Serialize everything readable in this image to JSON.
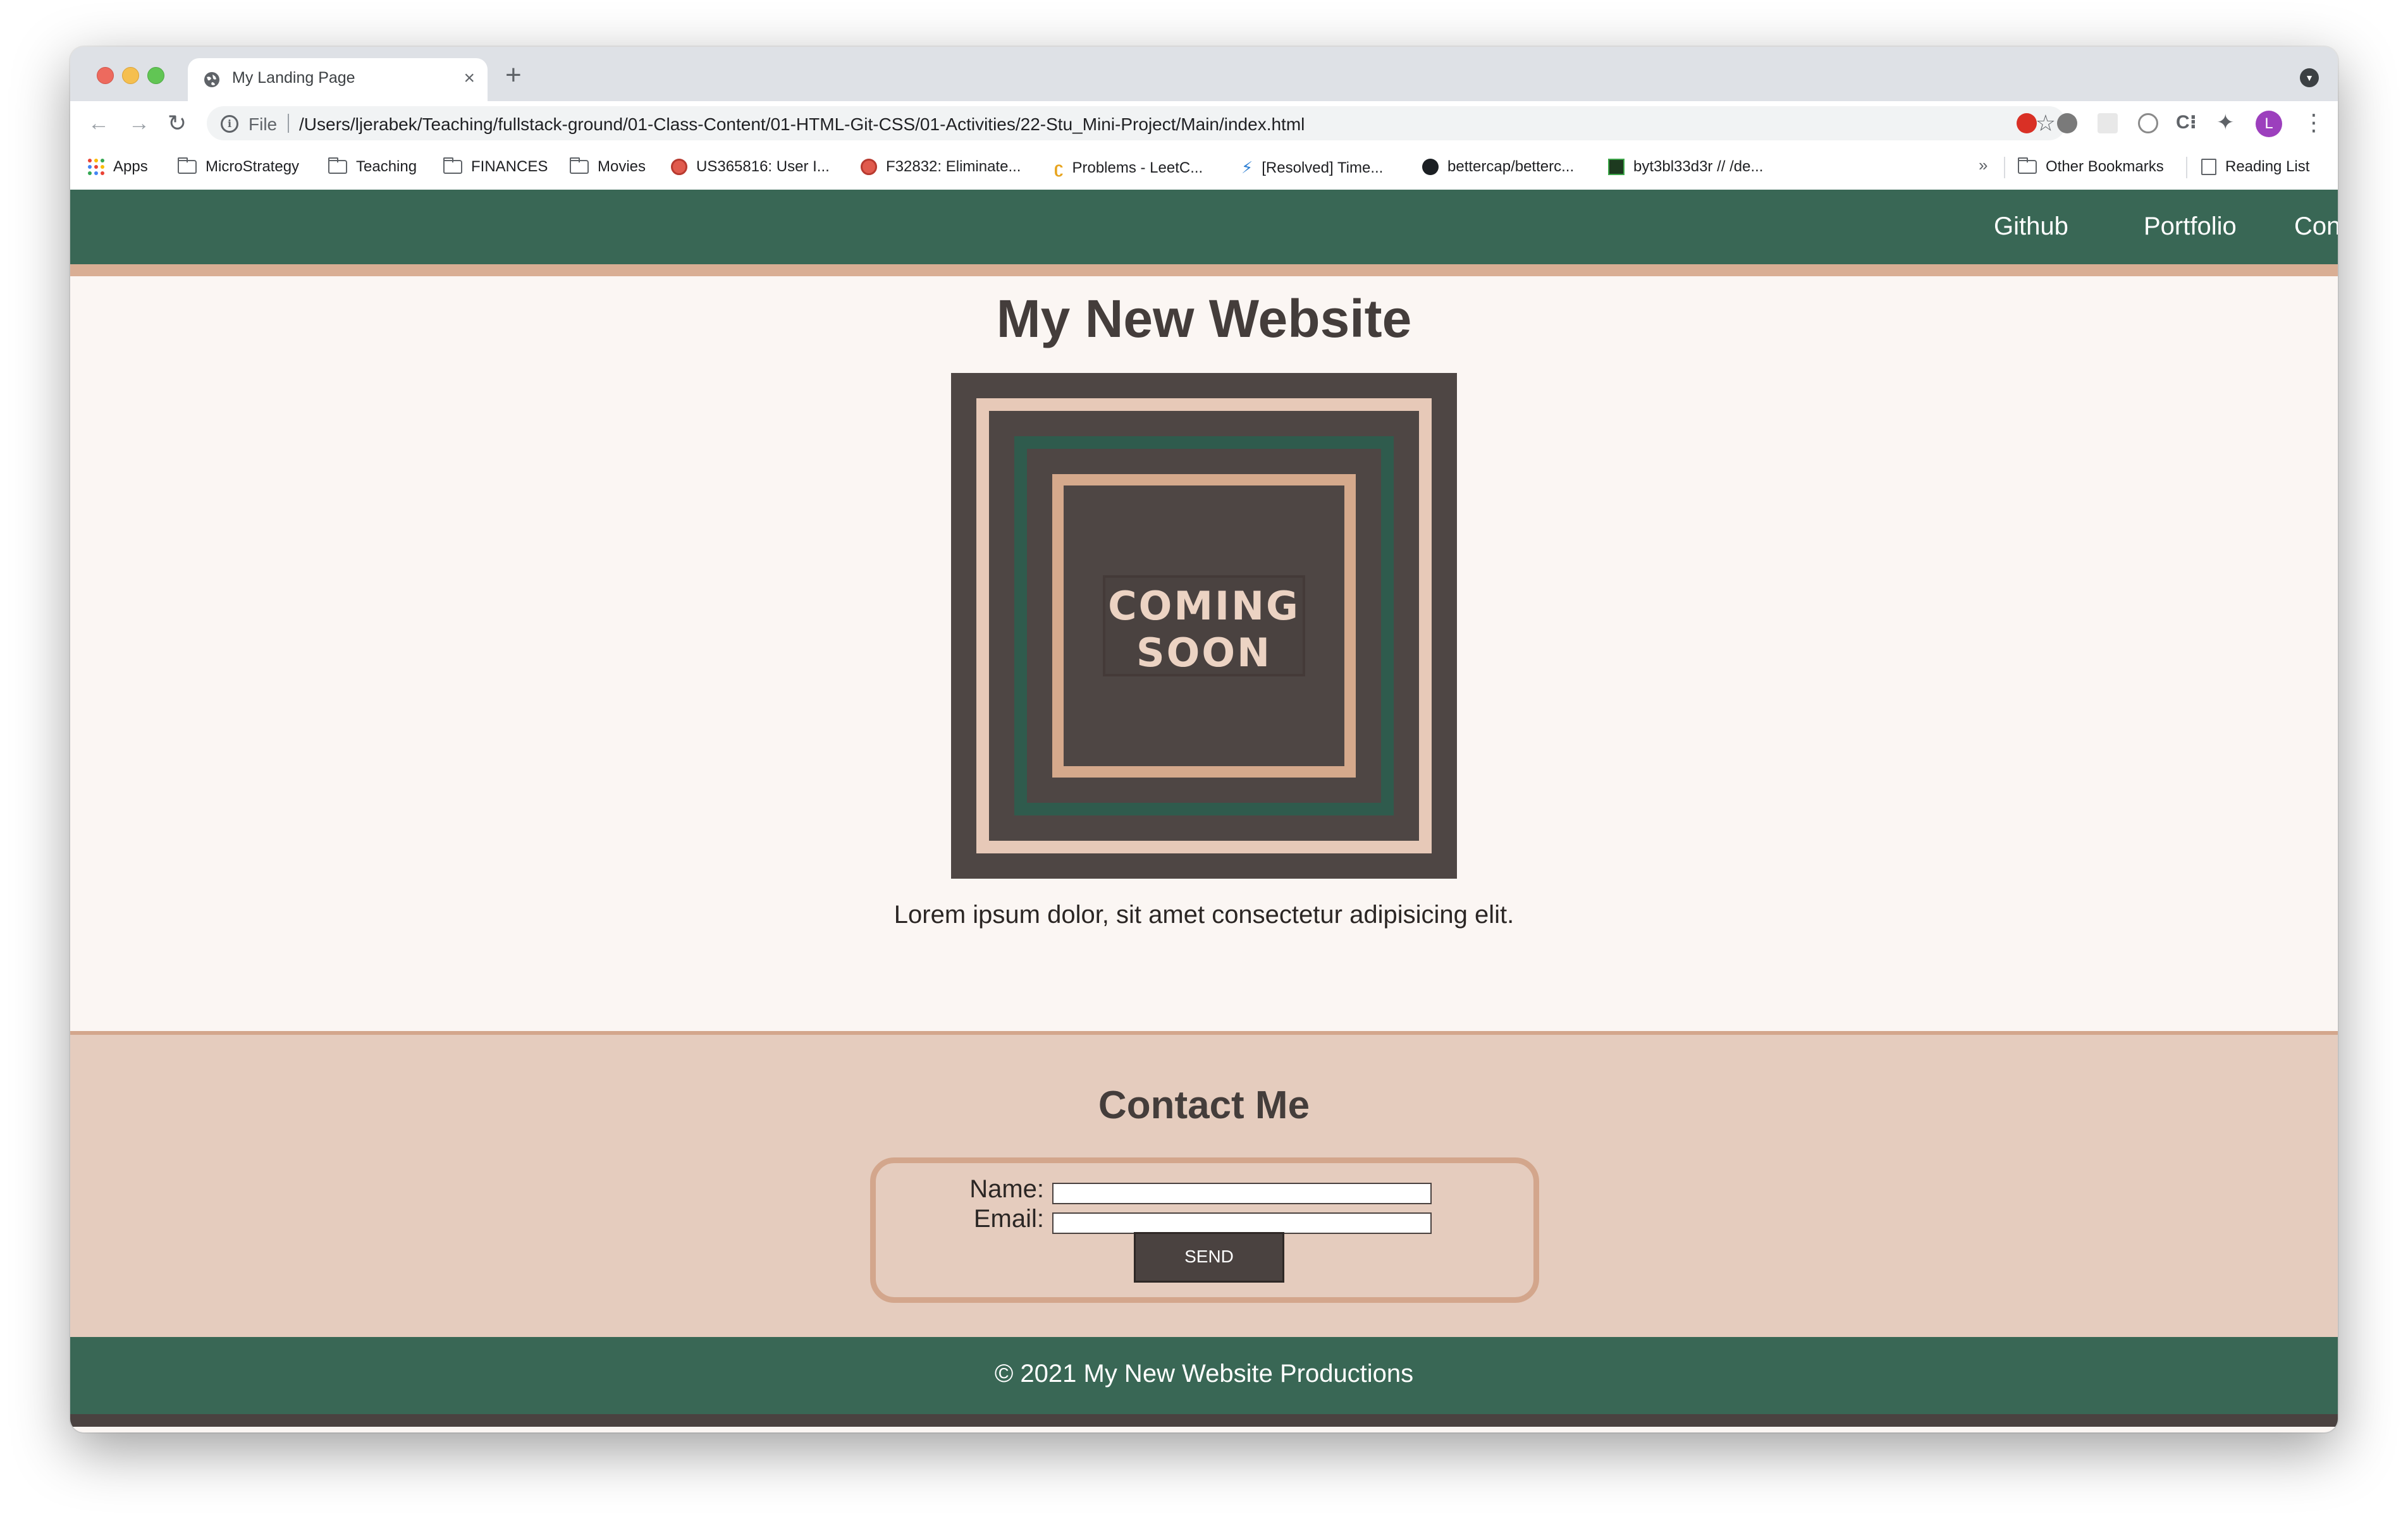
{
  "browser": {
    "tab": {
      "title": "My Landing Page",
      "close_icon": "×"
    },
    "new_tab_icon": "+",
    "toolbar": {
      "back_icon": "←",
      "forward_icon": "→",
      "reload_icon": "↻",
      "info_icon": "i",
      "file_label": "File",
      "url": "/Users/ljerabek/Teaching/fullstack-ground/01-Class-Content/01-HTML-Git-CSS/01-Activities/22-Stu_Mini-Project/Main/index.html",
      "star_icon": "☆",
      "ext_c_icon": "C⁝",
      "puzzle_icon": "✦",
      "avatar_letter": "L",
      "menu_icon": "⋮"
    },
    "bookmarks": {
      "items": [
        {
          "label": "Apps"
        },
        {
          "label": "MicroStrategy"
        },
        {
          "label": "Teaching"
        },
        {
          "label": "FINANCES"
        },
        {
          "label": "Movies"
        },
        {
          "label": "US365816: User I..."
        },
        {
          "label": "F32832: Eliminate..."
        },
        {
          "label": "Problems - LeetC..."
        },
        {
          "label": "[Resolved] Time..."
        },
        {
          "label": "bettercap/betterc..."
        },
        {
          "label": "byt3bl33d3r // /de..."
        }
      ],
      "more_icon": "»",
      "other_bookmarks": "Other Bookmarks",
      "reading_list": "Reading List"
    }
  },
  "site": {
    "nav": {
      "github": "Github",
      "portfolio": "Portfolio",
      "contact": "Contact"
    },
    "title": "My New Website",
    "hero_image": {
      "line1": "COMING",
      "line2": "SOON"
    },
    "intro": "Lorem ipsum dolor, sit amet consectetur adipisicing elit.",
    "contact": {
      "title": "Contact Me",
      "name_label": "Name:",
      "name_value": "",
      "email_label": "Email:",
      "email_value": "",
      "send_label": "SEND"
    },
    "footer": "© 2021 My New Website Productions"
  },
  "colors": {
    "header_green": "#396755",
    "accent_tan": "#d9ae94",
    "page_bg": "#fbf6f3",
    "contact_bg": "#e5ccbe",
    "dark_brown": "#4a4240",
    "heading_text": "#443d3b"
  }
}
